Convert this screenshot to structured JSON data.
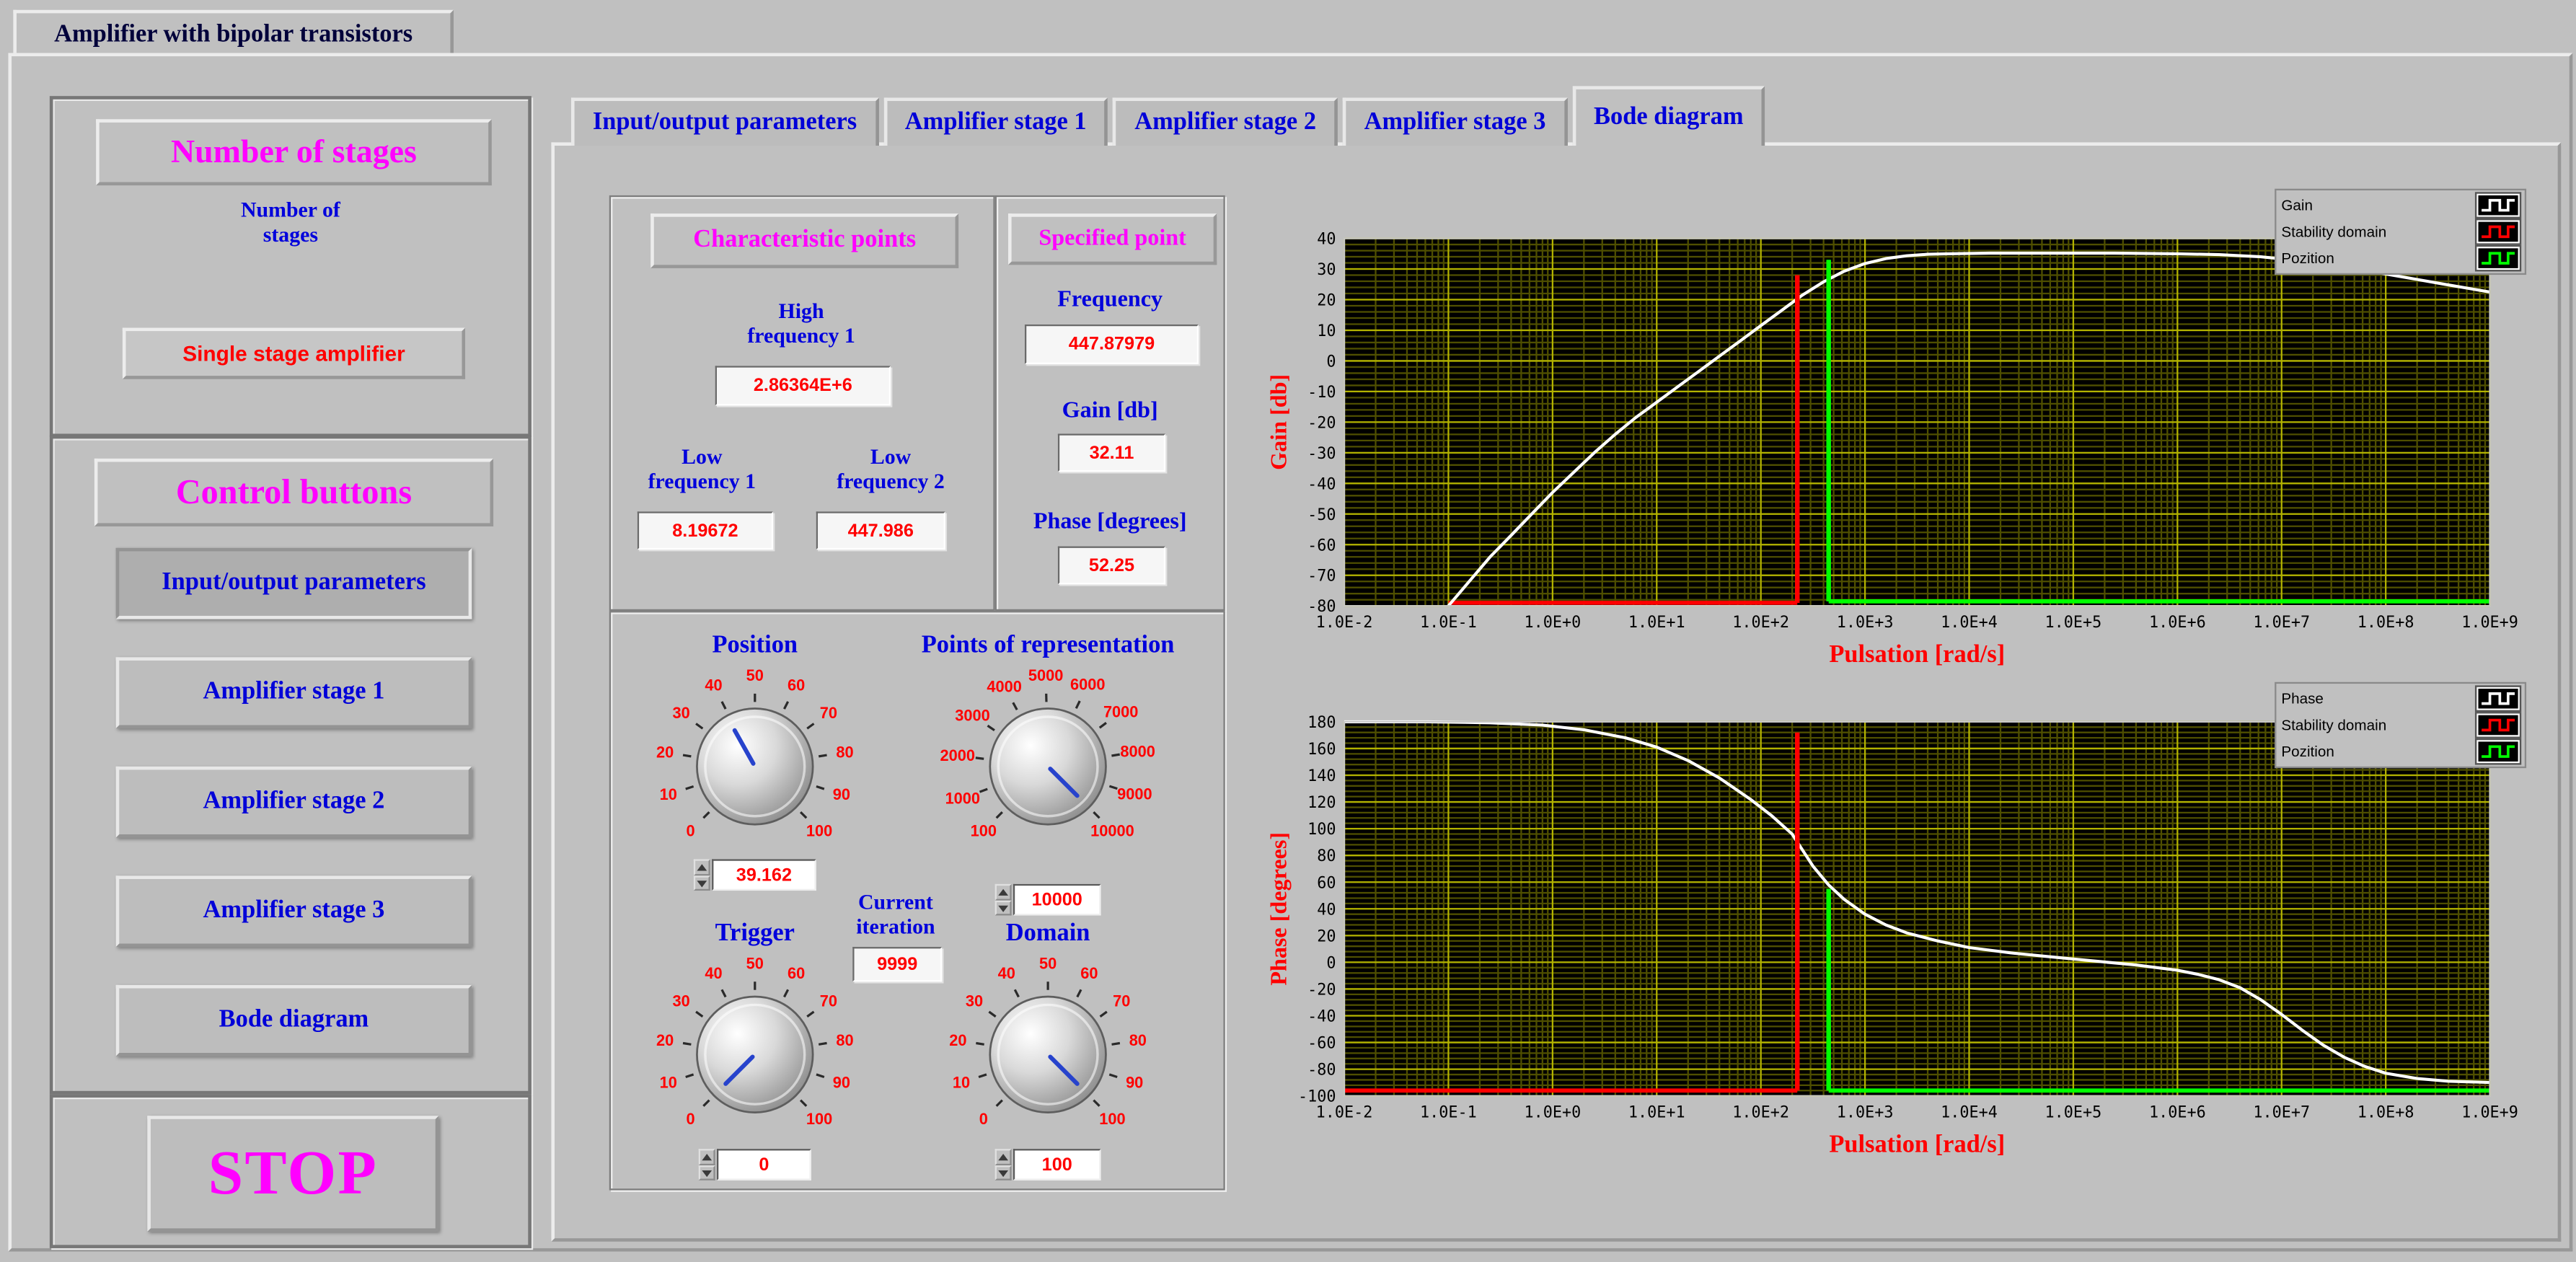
{
  "window": {
    "tab_title": "Amplifier with bipolar transistors"
  },
  "left_panel": {
    "number_of_stages": {
      "title": "Number of stages",
      "label_lines": [
        "Number of",
        "stages"
      ],
      "selector_value": "Single stage amplifier"
    },
    "control_buttons": {
      "title": "Control buttons",
      "buttons": [
        "Input/output parameters",
        "Amplifier stage 1",
        "Amplifier stage 2",
        "Amplifier stage 3",
        "Bode diagram"
      ]
    },
    "stop_button": "STOP"
  },
  "tab_control": {
    "tabs": [
      "Input/output parameters",
      "Amplifier stage 1",
      "Amplifier stage 2",
      "Amplifier stage 3",
      "Bode diagram"
    ],
    "active_tab": "Bode diagram"
  },
  "characteristic_points": {
    "title": "Characteristic points",
    "high_frequency_1": {
      "label_lines": [
        "High",
        "frequency 1"
      ],
      "value": "2.86364E+6"
    },
    "low_frequency_1": {
      "label_lines": [
        "Low",
        "frequency 1"
      ],
      "value": "8.19672"
    },
    "low_frequency_2": {
      "label_lines": [
        "Low",
        "frequency 2"
      ],
      "value": "447.986"
    }
  },
  "specified_point": {
    "title": "Specified point",
    "frequency": {
      "label": "Frequency",
      "value": "447.87979"
    },
    "gain": {
      "label": "Gain [db]",
      "value": "32.11"
    },
    "phase": {
      "label": "Phase [degrees]",
      "value": "52.25"
    }
  },
  "controls": {
    "position": {
      "label": "Position",
      "value": "39.162",
      "numeric": 39.162,
      "min": 0,
      "max": 100,
      "ticks": [
        0,
        10,
        20,
        30,
        40,
        50,
        60,
        70,
        80,
        90,
        100
      ]
    },
    "points_of_representation": {
      "label": "Points of representation",
      "value": "10000",
      "numeric": 10000,
      "min": 100,
      "max": 10000,
      "ticks": [
        100,
        1000,
        2000,
        3000,
        4000,
        5000,
        6000,
        7000,
        8000,
        9000,
        10000
      ]
    },
    "current_iteration": {
      "label_lines": [
        "Current",
        "iteration"
      ],
      "value": "9999"
    },
    "trigger": {
      "label": "Trigger",
      "value": "0",
      "numeric": 0,
      "min": 0,
      "max": 100,
      "ticks": [
        0,
        10,
        20,
        30,
        40,
        50,
        60,
        70,
        80,
        90,
        100
      ]
    },
    "domain": {
      "label": "Domain",
      "value": "100",
      "numeric": 100,
      "min": 0,
      "max": 100,
      "ticks": [
        0,
        10,
        20,
        30,
        40,
        50,
        60,
        70,
        80,
        90,
        100
      ]
    }
  },
  "chart_data": [
    {
      "type": "line",
      "name": "gain-bode",
      "ylabel": "Gain [db]",
      "xlabel": "Pulsation [rad/s]",
      "x_scale": "log",
      "x_log_range": [
        -2,
        9
      ],
      "xtick_labels": [
        "1.0E-2",
        "1.0E-1",
        "1.0E+0",
        "1.0E+1",
        "1.0E+2",
        "1.0E+3",
        "1.0E+4",
        "1.0E+5",
        "1.0E+6",
        "1.0E+7",
        "1.0E+8",
        "1.0E+9"
      ],
      "ylim": [
        -80,
        40
      ],
      "ytick_step": 10,
      "ytick_labels": [
        "40",
        "30",
        "20",
        "10",
        "0",
        "-10",
        "-20",
        "-30",
        "-40",
        "-50",
        "-60",
        "-70",
        "-80"
      ],
      "grid": true,
      "legend_position": "top-right",
      "legend": [
        {
          "label": "Gain",
          "color": "#ffffff"
        },
        {
          "label": "Stability domain",
          "color": "#ff0000"
        },
        {
          "label": "Pozition",
          "color": "#00ff00"
        }
      ],
      "series": [
        {
          "name": "Gain",
          "color": "#ffffff",
          "points_logx_y": [
            [
              -1,
              -80
            ],
            [
              -0.8,
              -72
            ],
            [
              -0.6,
              -64
            ],
            [
              -0.4,
              -57
            ],
            [
              -0.2,
              -50
            ],
            [
              0,
              -43
            ],
            [
              0.2,
              -36.5
            ],
            [
              0.4,
              -30
            ],
            [
              0.6,
              -24
            ],
            [
              0.8,
              -18.5
            ],
            [
              1,
              -13.5
            ],
            [
              1.2,
              -8.5
            ],
            [
              1.4,
              -3.5
            ],
            [
              1.6,
              1.5
            ],
            [
              1.8,
              6.5
            ],
            [
              2,
              11.5
            ],
            [
              2.2,
              16.5
            ],
            [
              2.4,
              21.5
            ],
            [
              2.6,
              25.8
            ],
            [
              2.8,
              29.3
            ],
            [
              3,
              31.8
            ],
            [
              3.2,
              33.4
            ],
            [
              3.4,
              34.3
            ],
            [
              3.6,
              34.8
            ],
            [
              3.8,
              35
            ],
            [
              4.2,
              35.2
            ],
            [
              4.8,
              35.2
            ],
            [
              5.4,
              35.2
            ],
            [
              6,
              35
            ],
            [
              6.4,
              34.7
            ],
            [
              6.8,
              34
            ],
            [
              7.1,
              33
            ],
            [
              7.4,
              31.7
            ],
            [
              7.7,
              30.1
            ],
            [
              8,
              28.4
            ],
            [
              8.3,
              26.6
            ],
            [
              8.6,
              24.8
            ],
            [
              9,
              22.5
            ]
          ]
        }
      ],
      "markers": [
        {
          "name": "Stability domain",
          "color": "#ff0000",
          "logx": 2.35,
          "y_top": 28,
          "baseline_y": -79,
          "baseline_from_logx": -1
        },
        {
          "name": "Pozition",
          "color": "#00ff00",
          "logx": 2.651,
          "y_top": 33,
          "baseline_y": -78.5,
          "baseline_to_logx": 9
        }
      ]
    },
    {
      "type": "line",
      "name": "phase-bode",
      "ylabel": "Phase [degrees]",
      "xlabel": "Pulsation [rad/s]",
      "x_scale": "log",
      "x_log_range": [
        -2,
        9
      ],
      "xtick_labels": [
        "1.0E-2",
        "1.0E-1",
        "1.0E+0",
        "1.0E+1",
        "1.0E+2",
        "1.0E+3",
        "1.0E+4",
        "1.0E+5",
        "1.0E+6",
        "1.0E+7",
        "1.0E+8",
        "1.0E+9"
      ],
      "ylim": [
        -100,
        180
      ],
      "ytick_step": 20,
      "ytick_labels": [
        "180",
        "160",
        "140",
        "120",
        "100",
        "80",
        "60",
        "40",
        "20",
        "0",
        "-20",
        "-40",
        "-60",
        "-80",
        "-100"
      ],
      "grid": true,
      "legend_position": "top-right",
      "legend": [
        {
          "label": "Phase",
          "color": "#ffffff"
        },
        {
          "label": "Stability domain",
          "color": "#ff0000"
        },
        {
          "label": "Pozition",
          "color": "#00ff00"
        }
      ],
      "series": [
        {
          "name": "Phase",
          "color": "#ffffff",
          "points_logx_y": [
            [
              -2,
              180
            ],
            [
              -1.2,
              180
            ],
            [
              -0.6,
              179.3
            ],
            [
              -0.1,
              177.5
            ],
            [
              0.3,
              174
            ],
            [
              0.7,
              168
            ],
            [
              1,
              161
            ],
            [
              1.3,
              151
            ],
            [
              1.6,
              138
            ],
            [
              1.9,
              122
            ],
            [
              2.1,
              110
            ],
            [
              2.3,
              96
            ],
            [
              2.5,
              72
            ],
            [
              2.65,
              58
            ],
            [
              2.8,
              47
            ],
            [
              3,
              36
            ],
            [
              3.2,
              28
            ],
            [
              3.4,
              22
            ],
            [
              3.7,
              16
            ],
            [
              4,
              11
            ],
            [
              4.4,
              7
            ],
            [
              4.8,
              4
            ],
            [
              5.2,
              1
            ],
            [
              5.6,
              -2
            ],
            [
              6,
              -6
            ],
            [
              6.2,
              -9
            ],
            [
              6.4,
              -13
            ],
            [
              6.6,
              -19
            ],
            [
              6.8,
              -28
            ],
            [
              7,
              -39
            ],
            [
              7.2,
              -51
            ],
            [
              7.4,
              -62
            ],
            [
              7.6,
              -71
            ],
            [
              7.8,
              -78
            ],
            [
              8,
              -83
            ],
            [
              8.3,
              -87
            ],
            [
              8.6,
              -89
            ],
            [
              9,
              -90
            ]
          ]
        }
      ],
      "markers": [
        {
          "name": "Stability domain",
          "color": "#ff0000",
          "logx": 2.35,
          "y_top": 172,
          "baseline_y": -96,
          "baseline_from_logx": -2
        },
        {
          "name": "Pozition",
          "color": "#00ff00",
          "logx": 2.651,
          "y_top": 55,
          "baseline_y": -96,
          "baseline_to_logx": 9
        }
      ]
    }
  ]
}
